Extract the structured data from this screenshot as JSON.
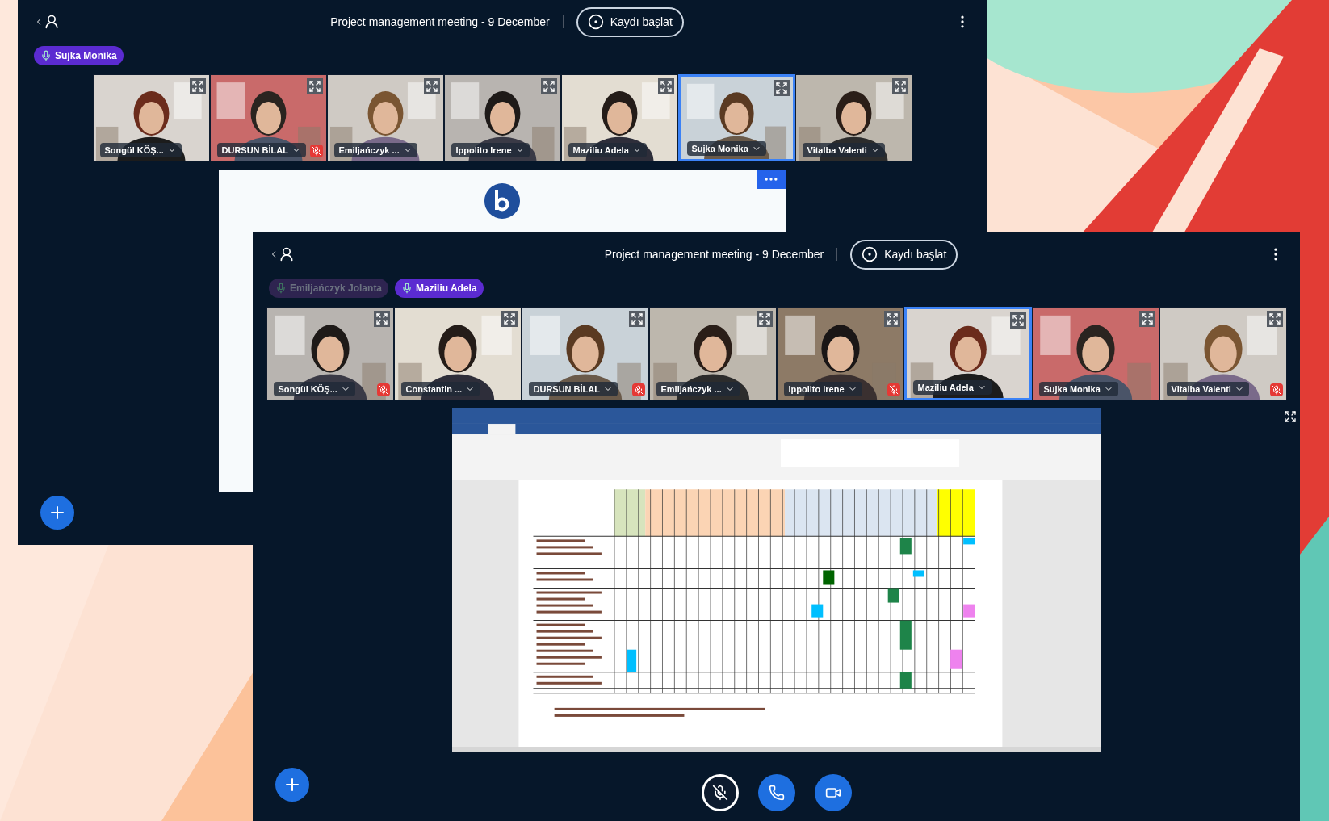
{
  "windows": [
    {
      "title": "Project management meeting - 9 December",
      "record_button": "Kaydı başlat",
      "talkers": [
        {
          "name": "Sujka Monika",
          "talking": true
        }
      ],
      "videos": [
        {
          "name": "Songül KÖŞ...",
          "muted": false,
          "selected": false
        },
        {
          "name": "DURSUN BİLAL",
          "muted": true,
          "selected": false
        },
        {
          "name": "Emiljańczyk ...",
          "muted": false,
          "selected": false
        },
        {
          "name": "Ippolito Irene",
          "muted": false,
          "selected": false
        },
        {
          "name": "Maziliu Adela",
          "muted": false,
          "selected": false
        },
        {
          "name": "Sujka Monika",
          "muted": false,
          "selected": true
        },
        {
          "name": "Vitalba Valenti",
          "muted": false,
          "selected": false
        }
      ],
      "presentation": {
        "kind": "welcome"
      }
    },
    {
      "title": "Project management meeting - 9 December",
      "record_button": "Kaydı başlat",
      "talkers": [
        {
          "name": "Emiljańczyk Jolanta",
          "talking": false
        },
        {
          "name": "Maziliu Adela",
          "talking": true
        }
      ],
      "videos": [
        {
          "name": "Songül KÖŞ...",
          "muted": true,
          "selected": false
        },
        {
          "name": "Constantin ...",
          "muted": false,
          "selected": false
        },
        {
          "name": "DURSUN BİLAL",
          "muted": true,
          "selected": false
        },
        {
          "name": "Emiljańczyk ...",
          "muted": false,
          "selected": false
        },
        {
          "name": "Ippolito Irene",
          "muted": true,
          "selected": false
        },
        {
          "name": "Maziliu Adela",
          "muted": false,
          "selected": true
        },
        {
          "name": "Sujka Monika",
          "muted": false,
          "selected": false
        },
        {
          "name": "Vitalba Valenti",
          "muted": true,
          "selected": false
        }
      ],
      "presentation": {
        "kind": "document"
      },
      "controls": [
        {
          "kind": "mic",
          "muted": true
        },
        {
          "kind": "phone"
        },
        {
          "kind": "camera"
        }
      ]
    }
  ]
}
